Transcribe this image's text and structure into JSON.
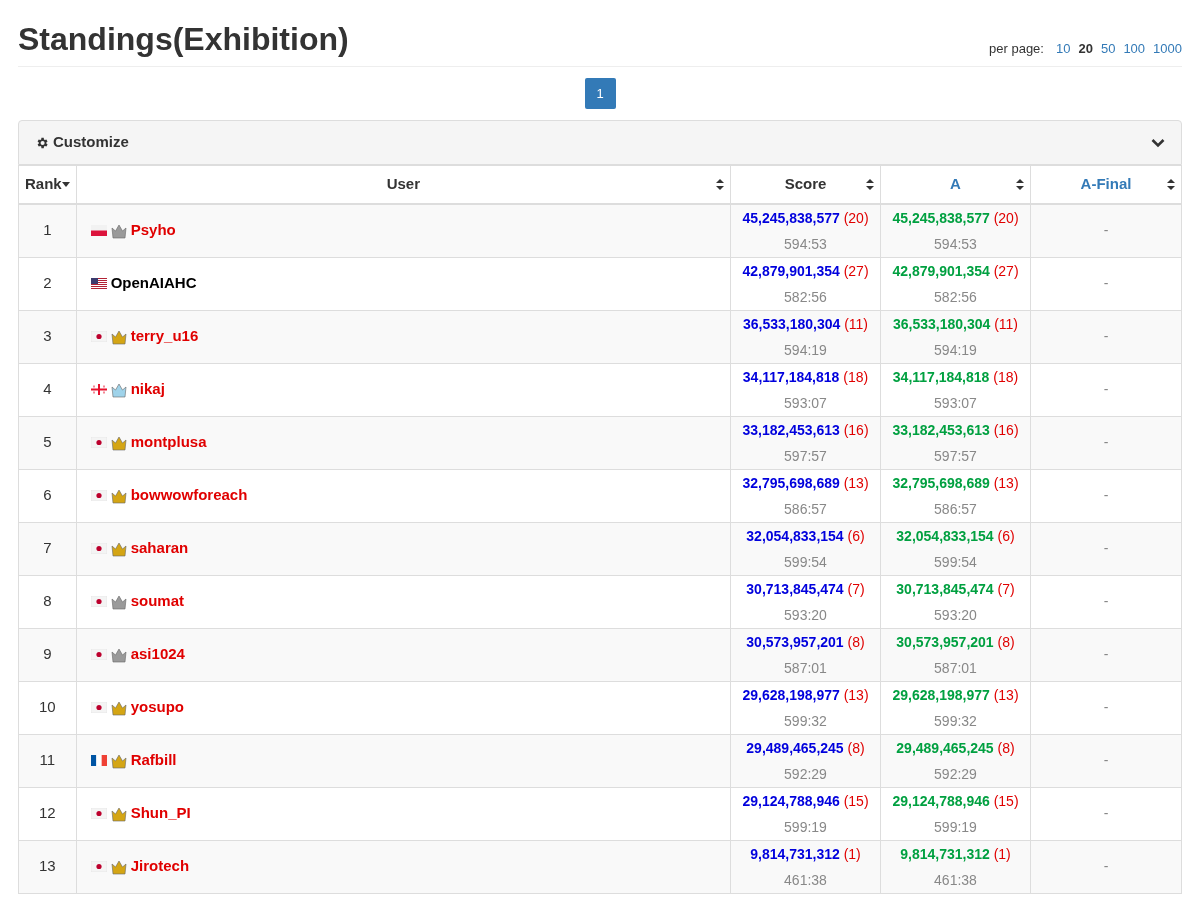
{
  "title": "Standings(Exhibition)",
  "per_page": {
    "label": "per page:",
    "options": [
      {
        "label": "10",
        "selected": false
      },
      {
        "label": "20",
        "selected": true
      },
      {
        "label": "50",
        "selected": false
      },
      {
        "label": "100",
        "selected": false
      },
      {
        "label": "1000",
        "selected": false
      }
    ]
  },
  "pagination": [
    {
      "label": "1",
      "selected": true
    }
  ],
  "customize": {
    "label": "Customize",
    "expanded": false
  },
  "table": {
    "columns": [
      {
        "label": "Rank",
        "kind": "dropdown",
        "link": false
      },
      {
        "label": "User",
        "kind": "sort",
        "link": false
      },
      {
        "label": "Score",
        "kind": "sort",
        "link": false
      },
      {
        "label": "A",
        "kind": "sort",
        "link": true
      },
      {
        "label": "A-Final",
        "kind": "sort",
        "link": true
      }
    ],
    "rows": [
      {
        "rank": "1",
        "flag": {
          "kind": "pl"
        },
        "crown": {
          "color": "#9a9a9a"
        },
        "user": "Psyho",
        "color": "#e00000",
        "score": "45,245,838,577",
        "score_count": "(20)",
        "score_time": "594:53",
        "a": "45,245,838,577",
        "a_count": "(20)",
        "a_time": "594:53",
        "a_final": "-"
      },
      {
        "rank": "2",
        "flag": {
          "kind": "us"
        },
        "user": "OpenAIAHC",
        "color": "#000000",
        "score": "42,879,901,354",
        "score_count": "(27)",
        "score_time": "582:56",
        "a": "42,879,901,354",
        "a_count": "(27)",
        "a_time": "582:56",
        "a_final": "-"
      },
      {
        "rank": "3",
        "flag": {
          "kind": "jp"
        },
        "crown": {
          "color": "#d4a514"
        },
        "user": "terry_u16",
        "color": "#e00000",
        "score": "36,533,180,304",
        "score_count": "(11)",
        "score_time": "594:19",
        "a": "36,533,180,304",
        "a_count": "(11)",
        "a_time": "594:19",
        "a_final": "-"
      },
      {
        "rank": "4",
        "flag": {
          "kind": "ge"
        },
        "crown": {
          "color": "#9fd3ea"
        },
        "user": "nikaj",
        "color": "#e00000",
        "score": "34,117,184,818",
        "score_count": "(18)",
        "score_time": "593:07",
        "a": "34,117,184,818",
        "a_count": "(18)",
        "a_time": "593:07",
        "a_final": "-"
      },
      {
        "rank": "5",
        "flag": {
          "kind": "jp"
        },
        "crown": {
          "color": "#d4a514"
        },
        "user": "montplusa",
        "color": "#e00000",
        "score": "33,182,453,613",
        "score_count": "(16)",
        "score_time": "597:57",
        "a": "33,182,453,613",
        "a_count": "(16)",
        "a_time": "597:57",
        "a_final": "-"
      },
      {
        "rank": "6",
        "flag": {
          "kind": "jp"
        },
        "crown": {
          "color": "#d4a514"
        },
        "user": "bowwowforeach",
        "color": "#e00000",
        "score": "32,795,698,689",
        "score_count": "(13)",
        "score_time": "586:57",
        "a": "32,795,698,689",
        "a_count": "(13)",
        "a_time": "586:57",
        "a_final": "-"
      },
      {
        "rank": "7",
        "flag": {
          "kind": "jp"
        },
        "crown": {
          "color": "#d4a514"
        },
        "user": "saharan",
        "color": "#e00000",
        "score": "32,054,833,154",
        "score_count": "(6)",
        "score_time": "599:54",
        "a": "32,054,833,154",
        "a_count": "(6)",
        "a_time": "599:54",
        "a_final": "-"
      },
      {
        "rank": "8",
        "flag": {
          "kind": "jp"
        },
        "crown": {
          "color": "#9a9a9a"
        },
        "user": "soumat",
        "color": "#e00000",
        "score": "30,713,845,474",
        "score_count": "(7)",
        "score_time": "593:20",
        "a": "30,713,845,474",
        "a_count": "(7)",
        "a_time": "593:20",
        "a_final": "-"
      },
      {
        "rank": "9",
        "flag": {
          "kind": "jp"
        },
        "crown": {
          "color": "#9a9a9a"
        },
        "user": "asi1024",
        "color": "#e00000",
        "score": "30,573,957,201",
        "score_count": "(8)",
        "score_time": "587:01",
        "a": "30,573,957,201",
        "a_count": "(8)",
        "a_time": "587:01",
        "a_final": "-"
      },
      {
        "rank": "10",
        "flag": {
          "kind": "jp"
        },
        "crown": {
          "color": "#d4a514"
        },
        "user": "yosupo",
        "color": "#e00000",
        "score": "29,628,198,977",
        "score_count": "(13)",
        "score_time": "599:32",
        "a": "29,628,198,977",
        "a_count": "(13)",
        "a_time": "599:32",
        "a_final": "-"
      },
      {
        "rank": "11",
        "flag": {
          "kind": "fr"
        },
        "crown": {
          "color": "#d4a514"
        },
        "user": "Rafbill",
        "color": "#e00000",
        "score": "29,489,465,245",
        "score_count": "(8)",
        "score_time": "592:29",
        "a": "29,489,465,245",
        "a_count": "(8)",
        "a_time": "592:29",
        "a_final": "-"
      },
      {
        "rank": "12",
        "flag": {
          "kind": "jp"
        },
        "crown": {
          "color": "#d4a514"
        },
        "user": "Shun_PI",
        "color": "#e00000",
        "score": "29,124,788,946",
        "score_count": "(15)",
        "score_time": "599:19",
        "a": "29,124,788,946",
        "a_count": "(15)",
        "a_time": "599:19",
        "a_final": "-"
      },
      {
        "rank": "13",
        "flag": {
          "kind": "jp"
        },
        "crown": {
          "color": "#d4a514"
        },
        "user": "Jirotech",
        "color": "#e00000",
        "score": "9,814,731,312",
        "score_count": "(1)",
        "score_time": "461:38",
        "a": "9,814,731,312",
        "a_count": "(1)",
        "a_time": "461:38",
        "a_final": "-"
      }
    ]
  }
}
